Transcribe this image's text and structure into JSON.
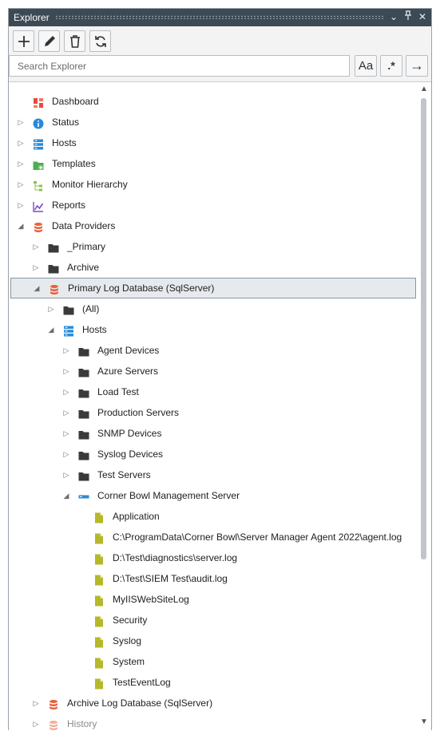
{
  "window": {
    "title": "Explorer",
    "dropdown_glyph": "⌄",
    "pin_glyph": "⊥",
    "close_glyph": "✕"
  },
  "search": {
    "placeholder": "Search Explorer",
    "case_label": "Aa",
    "regex_label": ".*",
    "go_label": "→"
  },
  "tree": [
    {
      "label": "Dashboard",
      "indent": 0,
      "expander": "none",
      "icon": "dashboard-icon"
    },
    {
      "label": "Status",
      "indent": 0,
      "expander": "collapsed",
      "icon": "info-icon"
    },
    {
      "label": "Hosts",
      "indent": 0,
      "expander": "collapsed",
      "icon": "hosts-icon"
    },
    {
      "label": "Templates",
      "indent": 0,
      "expander": "collapsed",
      "icon": "templates-icon"
    },
    {
      "label": "Monitor Hierarchy",
      "indent": 0,
      "expander": "collapsed",
      "icon": "hierarchy-icon"
    },
    {
      "label": "Reports",
      "indent": 0,
      "expander": "collapsed",
      "icon": "reports-icon"
    },
    {
      "label": "Data Providers",
      "indent": 0,
      "expander": "expanded",
      "icon": "database-icon"
    },
    {
      "label": "_Primary",
      "indent": 1,
      "expander": "collapsed",
      "icon": "folder-icon"
    },
    {
      "label": "Archive",
      "indent": 1,
      "expander": "collapsed",
      "icon": "folder-icon"
    },
    {
      "label": "Primary Log Database (SqlServer)",
      "indent": 1,
      "expander": "expanded",
      "icon": "database-icon",
      "selected": true
    },
    {
      "label": "(All)",
      "indent": 2,
      "expander": "collapsed",
      "icon": "folder-icon"
    },
    {
      "label": "Hosts",
      "indent": 2,
      "expander": "expanded",
      "icon": "hosts-icon"
    },
    {
      "label": "Agent Devices",
      "indent": 3,
      "expander": "collapsed",
      "icon": "folder-icon"
    },
    {
      "label": "Azure Servers",
      "indent": 3,
      "expander": "collapsed",
      "icon": "folder-icon"
    },
    {
      "label": "Load Test",
      "indent": 3,
      "expander": "collapsed",
      "icon": "folder-icon"
    },
    {
      "label": "Production Servers",
      "indent": 3,
      "expander": "collapsed",
      "icon": "folder-icon"
    },
    {
      "label": "SNMP Devices",
      "indent": 3,
      "expander": "collapsed",
      "icon": "folder-icon"
    },
    {
      "label": "Syslog Devices",
      "indent": 3,
      "expander": "collapsed",
      "icon": "folder-icon"
    },
    {
      "label": "Test Servers",
      "indent": 3,
      "expander": "collapsed",
      "icon": "folder-icon"
    },
    {
      "label": "Corner Bowl Management Server",
      "indent": 3,
      "expander": "expanded",
      "icon": "server-icon"
    },
    {
      "label": "Application",
      "indent": 4,
      "expander": "none",
      "icon": "log-file-icon"
    },
    {
      "label": "C:\\ProgramData\\Corner Bowl\\Server Manager Agent 2022\\agent.log",
      "indent": 4,
      "expander": "none",
      "icon": "log-file-icon"
    },
    {
      "label": "D:\\Test\\diagnostics\\server.log",
      "indent": 4,
      "expander": "none",
      "icon": "log-file-icon"
    },
    {
      "label": "D:\\Test\\SIEM Test\\audit.log",
      "indent": 4,
      "expander": "none",
      "icon": "log-file-icon"
    },
    {
      "label": "MyIISWebSiteLog",
      "indent": 4,
      "expander": "none",
      "icon": "log-file-icon"
    },
    {
      "label": "Security",
      "indent": 4,
      "expander": "none",
      "icon": "log-file-icon"
    },
    {
      "label": "Syslog",
      "indent": 4,
      "expander": "none",
      "icon": "log-file-icon"
    },
    {
      "label": "System",
      "indent": 4,
      "expander": "none",
      "icon": "log-file-icon"
    },
    {
      "label": "TestEventLog",
      "indent": 4,
      "expander": "none",
      "icon": "log-file-icon"
    },
    {
      "label": "Archive Log Database (SqlServer)",
      "indent": 1,
      "expander": "collapsed",
      "icon": "database-icon"
    },
    {
      "label": "History",
      "indent": 1,
      "expander": "collapsed",
      "icon": "database-icon",
      "dim": true
    }
  ],
  "colors": {
    "titlebar": "#3c4a55",
    "database": "#e8613c",
    "folder": "#3a3a3a",
    "logfile": "#b5b82a",
    "hosts": "#2a8ad8",
    "info": "#2a8ad8",
    "reports": "#7a4cc2",
    "templates": "#4caf50",
    "hierarchy": "#8bc34a",
    "dashboard_a": "#e84a3c",
    "dashboard_b": "#f0786b"
  }
}
